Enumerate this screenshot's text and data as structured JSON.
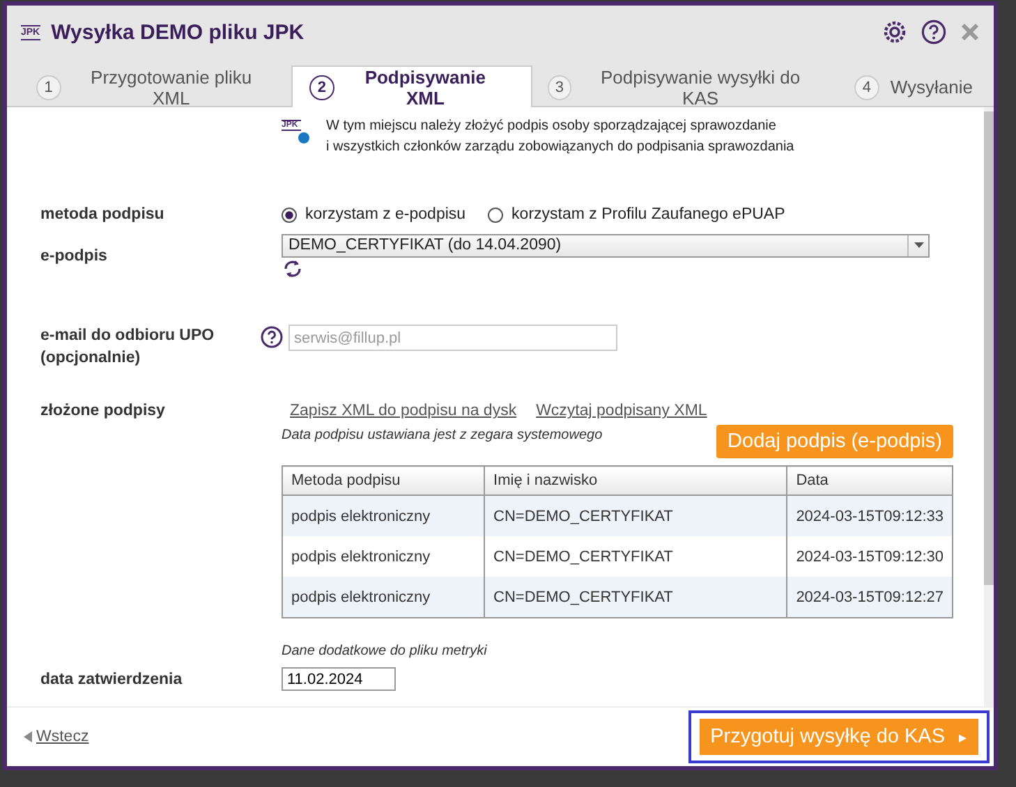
{
  "window": {
    "title": "Wysyłka DEMO pliku JPK",
    "logo": "JPK"
  },
  "tabs": [
    {
      "number": "1",
      "label": "Przygotowanie pliku XML",
      "selected": false
    },
    {
      "number": "2",
      "label": "Podpisywanie XML",
      "selected": true
    },
    {
      "number": "3",
      "label": "Podpisywanie wysyłki do KAS",
      "selected": false
    },
    {
      "number": "4",
      "label": "Wysyłanie",
      "selected": false
    }
  ],
  "info": {
    "badge": "JPK",
    "text": "W tym miejscu należy złożyć podpis osoby sporządzającej sprawozdanie\ni wszystkich członków zarządu zobowiązanych do podpisania sprawozdania"
  },
  "signature_method": {
    "label": "metoda podpisu",
    "options": [
      {
        "label": "korzystam z e-podpisu",
        "selected": true
      },
      {
        "label": "korzystam z Profilu Zaufanego ePUAP",
        "selected": false
      }
    ]
  },
  "e_signature": {
    "label": "e-podpis",
    "value": "DEMO_CERTYFIKAT (do 14.04.2090)"
  },
  "email": {
    "label": "e-mail do odbioru UPO\n(opcjonalnie)",
    "placeholder": "serwis@fillup.pl"
  },
  "signatures": {
    "label": "złożone podpisy",
    "links": [
      "Zapisz XML do podpisu na dysk",
      "Wczytaj podpisany XML"
    ],
    "note": "Data podpisu ustawiana jest z zegara systemowego",
    "add_button": "Dodaj podpis (e-podpis)",
    "table": {
      "columns": [
        "Metoda podpisu",
        "Imię i nazwisko",
        "Data"
      ],
      "rows": [
        [
          "podpis elektroniczny",
          "CN=DEMO_CERTYFIKAT",
          "2024-03-15T09:12:33"
        ],
        [
          "podpis elektroniczny",
          "CN=DEMO_CERTYFIKAT",
          "2024-03-15T09:12:30"
        ],
        [
          "podpis elektroniczny",
          "CN=DEMO_CERTYFIKAT",
          "2024-03-15T09:12:27"
        ]
      ]
    }
  },
  "metrics_note": "Dane dodatkowe do pliku metryki",
  "approval_date": {
    "label": "data zatwierdzenia",
    "value": "11.02.2024"
  },
  "footer": {
    "back": "Wstecz",
    "next": "Przygotuj wysyłkę do KAS",
    "next_marker": "▸"
  }
}
